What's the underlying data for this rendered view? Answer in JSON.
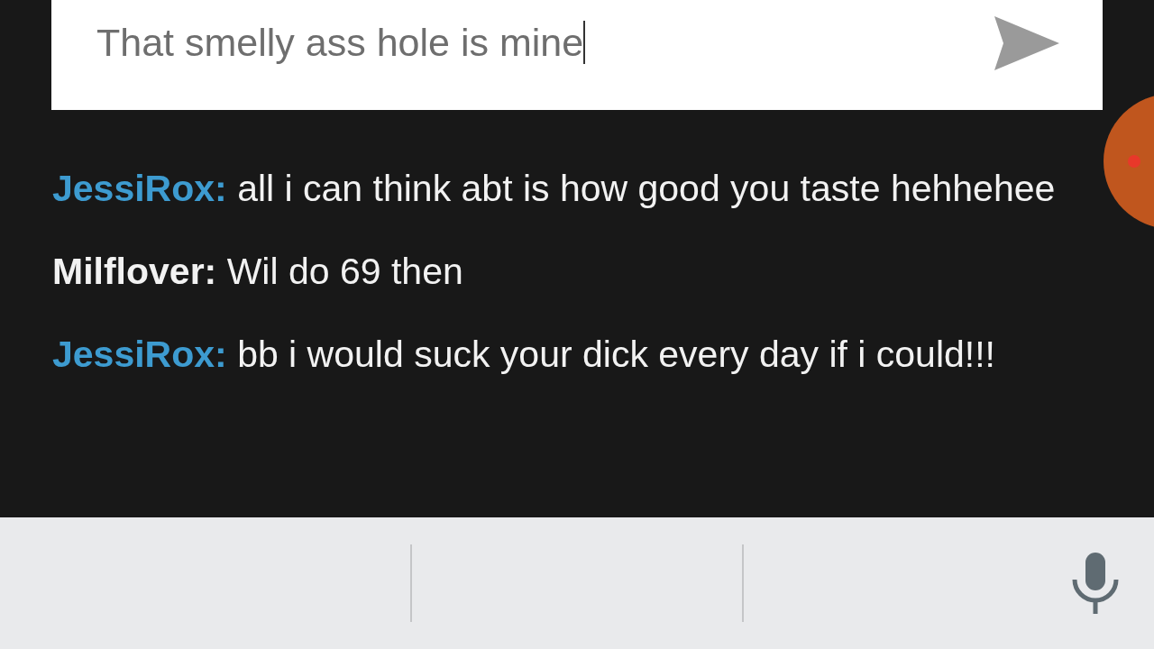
{
  "compose": {
    "value": "That smelly ass hole is mine"
  },
  "messages": [
    {
      "sender": "JessiRox:",
      "color": "#3d9bd0",
      "text": "all i can think abt is how good you taste hehhehee"
    },
    {
      "sender": "Milflover:",
      "color": "#f2f2f2",
      "text": "Wil do 69 then"
    },
    {
      "sender": "JessiRox:",
      "color": "#3d9bd0",
      "text": "bb i would suck your dick every day if i could!!!"
    }
  ]
}
